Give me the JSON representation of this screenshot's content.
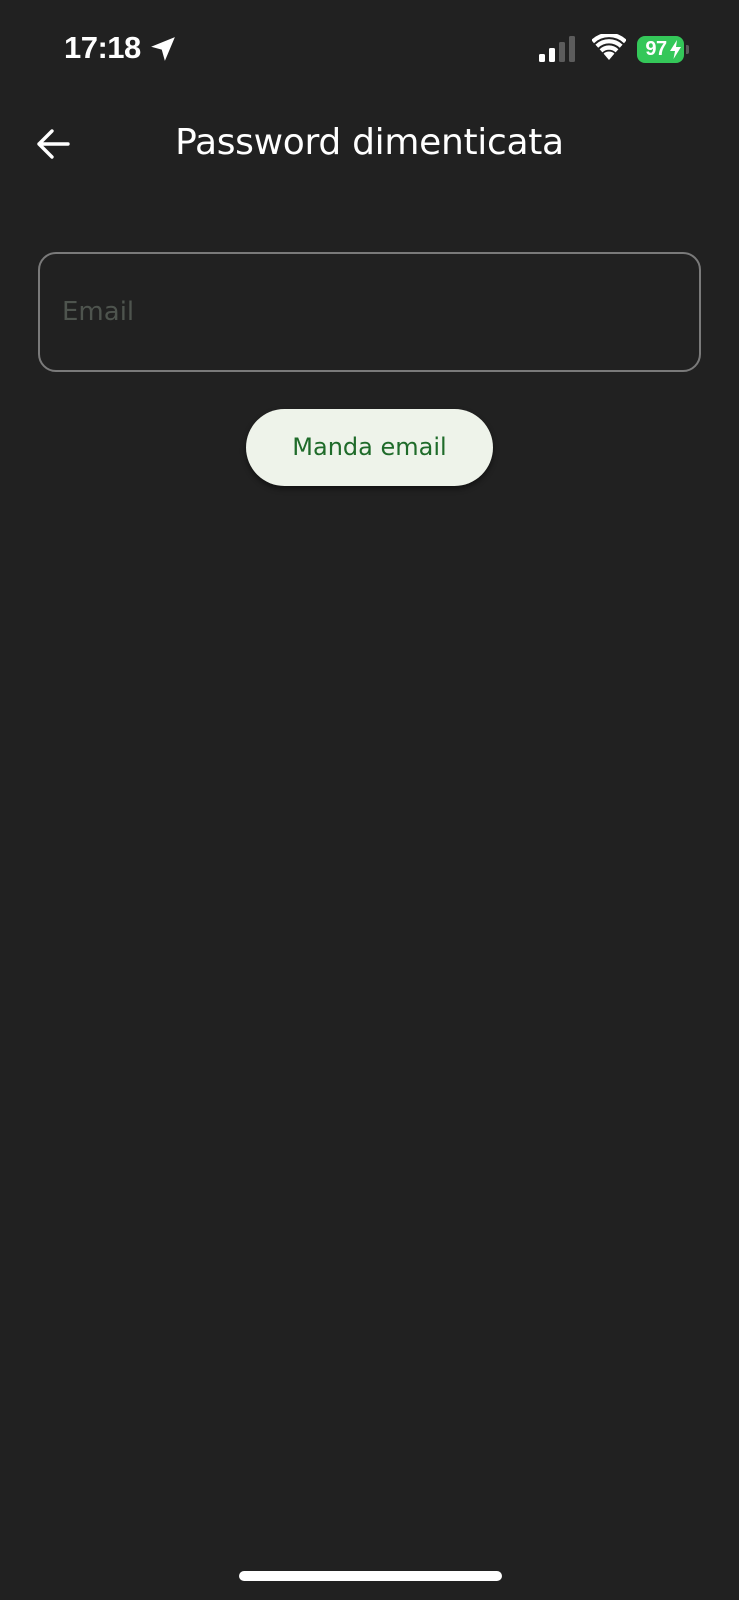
{
  "status_bar": {
    "time": "17:18",
    "battery_level": "97",
    "icons": {
      "location": "location-arrow-icon",
      "signal": "cellular-signal-icon",
      "wifi": "wifi-icon",
      "battery": "battery-charging-icon"
    },
    "colors": {
      "battery": "#34c759"
    }
  },
  "app_bar": {
    "title": "Password dimenticata",
    "back_icon": "arrow-left-icon"
  },
  "form": {
    "email_placeholder": "Email",
    "email_value": "",
    "send_button_label": "Manda email"
  },
  "colors": {
    "background": "#212121",
    "button_background": "#eef3ea",
    "button_text": "#1f6b2a",
    "field_border": "#7a7a7a",
    "placeholder": "#4e544e"
  }
}
